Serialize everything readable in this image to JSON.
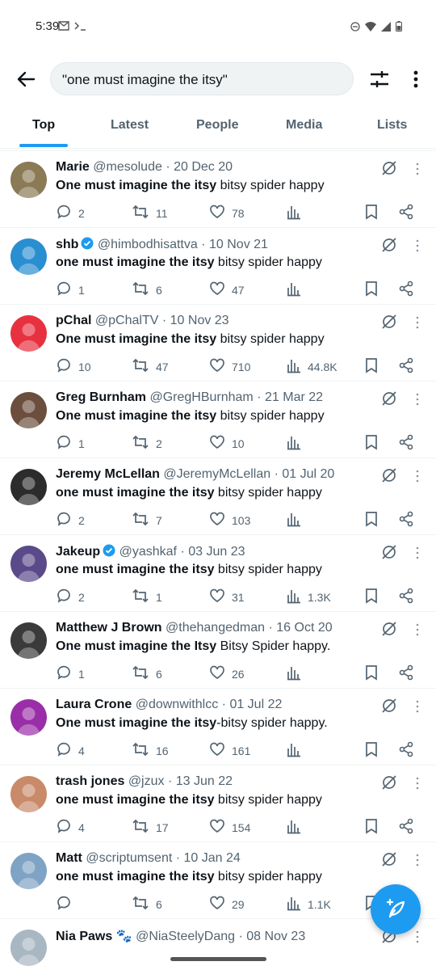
{
  "status_bar": {
    "time": "5:39"
  },
  "search": {
    "query": "\"one must imagine the itsy\""
  },
  "tabs": [
    {
      "label": "Top",
      "active": true
    },
    {
      "label": "Latest",
      "active": false
    },
    {
      "label": "People",
      "active": false
    },
    {
      "label": "Media",
      "active": false
    },
    {
      "label": "Lists",
      "active": false
    }
  ],
  "colors": {
    "accent": "#1d9bf0",
    "text": "#0f1419",
    "secondary": "#536471"
  },
  "tweets": [
    {
      "name": "Marie",
      "handle": "@mesolude",
      "dot": "·",
      "date": "20 Dec 20",
      "verified": false,
      "bold": "One must imagine the itsy",
      "rest": " bitsy spider happy",
      "replies": "2",
      "retweets": "11",
      "likes": "78",
      "views": ""
    },
    {
      "name": "shb",
      "handle": "@himbodhisattva",
      "dot": "·",
      "date": "10 Nov 21",
      "verified": true,
      "bold": "one must imagine the itsy",
      "rest": " bitsy spider happy",
      "replies": "1",
      "retweets": "6",
      "likes": "47",
      "views": ""
    },
    {
      "name": "pChal",
      "handle": "@pChalTV",
      "dot": "·",
      "date": "10 Nov 23",
      "verified": false,
      "bold": "One must imagine the itsy",
      "rest": " bitsy spider happy",
      "replies": "10",
      "retweets": "47",
      "likes": "710",
      "views": "44.8K"
    },
    {
      "name": "Greg Burnham",
      "handle": "@GregHBurnham",
      "dot": "·",
      "date": "21 Mar 22",
      "verified": false,
      "bold": "One must imagine the itsy",
      "rest": " bitsy spider happy",
      "replies": "1",
      "retweets": "2",
      "likes": "10",
      "views": ""
    },
    {
      "name": "Jeremy McLellan",
      "handle": "@JeremyMcLellan",
      "dot": "·",
      "date": "01 Jul 20",
      "verified": false,
      "bold": "one must imagine the itsy",
      "rest": " bitsy spider happy",
      "replies": "2",
      "retweets": "7",
      "likes": "103",
      "views": ""
    },
    {
      "name": "Jakeup",
      "handle": "@yashkaf",
      "dot": "·",
      "date": "03 Jun 23",
      "verified": true,
      "bold": "one must imagine the itsy",
      "rest": " bitsy spider happy",
      "replies": "2",
      "retweets": "1",
      "likes": "31",
      "views": "1.3K"
    },
    {
      "name": "Matthew J Brown",
      "handle": "@thehangedman",
      "dot": "·",
      "date": "16 Oct 20",
      "verified": false,
      "bold": "One must imagine the Itsy",
      "rest": " Bitsy Spider happy.",
      "replies": "1",
      "retweets": "6",
      "likes": "26",
      "views": ""
    },
    {
      "name": "Laura Crone",
      "handle": "@downwithlcc",
      "dot": "·",
      "date": "01 Jul 22",
      "verified": false,
      "bold": "One must imagine the itsy",
      "rest": "-bitsy spider happy.",
      "replies": "4",
      "retweets": "16",
      "likes": "161",
      "views": ""
    },
    {
      "name": "trash jones",
      "handle": "@jzux",
      "dot": "·",
      "date": "13 Jun 22",
      "verified": false,
      "bold": "one must imagine the itsy",
      "rest": " bitsy spider happy",
      "replies": "4",
      "retweets": "17",
      "likes": "154",
      "views": ""
    },
    {
      "name": "Matt",
      "handle": "@scriptumsent",
      "dot": "·",
      "date": "10 Jan 24",
      "verified": false,
      "bold": "one must imagine the itsy",
      "rest": " bitsy spider happy",
      "replies": "",
      "retweets": "6",
      "likes": "29",
      "views": "1.1K"
    },
    {
      "name": "Nia Paws 🐾",
      "handle": "@NiaSteelyDang",
      "dot": "·",
      "date": "08 Nov 23",
      "verified": false,
      "bold": "",
      "rest": "",
      "replies": "",
      "retweets": "",
      "likes": "",
      "views": ""
    }
  ]
}
